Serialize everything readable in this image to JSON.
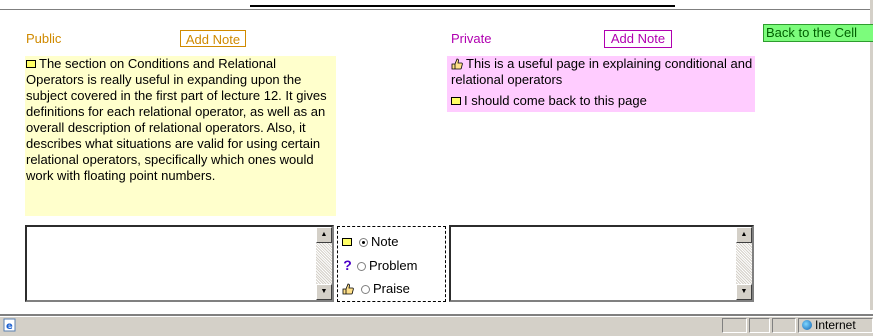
{
  "public": {
    "label": "Public",
    "add_note": "Add Note",
    "note_text": "The section on Conditions and Relational Operators is really useful in expanding upon the subject covered in the first part of lecture 12. It gives definitions for each relational operator, as well as an overall description of relational operators. Also, it describes what situations are valid for using certain relational operators, specifically which ones would work with floating point numbers."
  },
  "private": {
    "label": "Private",
    "add_note": "Add Note",
    "notes": [
      {
        "icon": "thumbs-up-icon",
        "text": "This is a useful page in explaining conditional and relational operators"
      },
      {
        "icon": "note-icon",
        "text": "I should come back to this page"
      }
    ]
  },
  "back_button": "Back to the Cell",
  "note_type": {
    "options": [
      {
        "icon": "note-icon",
        "label": "Note",
        "selected": true
      },
      {
        "icon": "question-icon",
        "label": "Problem",
        "selected": false
      },
      {
        "icon": "thumbs-up-icon",
        "label": "Praise",
        "selected": false
      }
    ]
  },
  "status": {
    "zone": "Internet"
  },
  "colors": {
    "public": "#d08a00",
    "private": "#b000b0",
    "public_bg": "#ffffcc",
    "private_bg": "#ffccff",
    "back_btn": "#7cfc7c"
  }
}
